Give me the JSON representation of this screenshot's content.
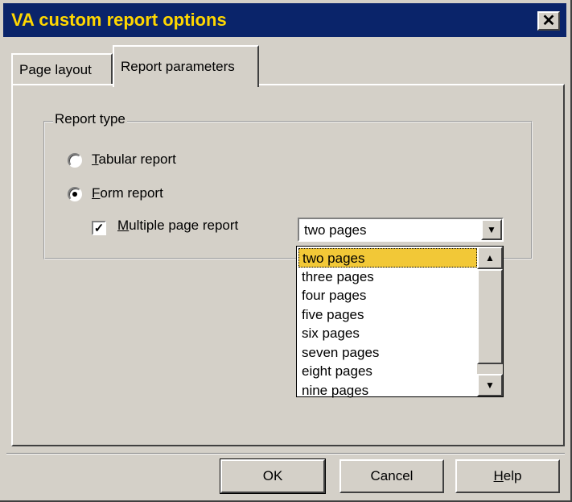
{
  "window": {
    "title": "VA custom report options",
    "close_symbol": "✕"
  },
  "tabs": [
    {
      "label": "Page layout",
      "active": false
    },
    {
      "label": "Report parameters",
      "active": true
    }
  ],
  "report_type": {
    "group_label": "Report type",
    "tabular": {
      "label_mnemonic": "T",
      "label_rest": "abular report",
      "selected": false
    },
    "form": {
      "label_mnemonic": "F",
      "label_rest": "orm report",
      "selected": true
    },
    "multiple_page": {
      "label_mnemonic": "M",
      "label_rest": "ultiple page report",
      "checked": true,
      "check_mark": "✓"
    }
  },
  "pages_combo": {
    "value": "two pages",
    "options": [
      "two pages",
      "three pages",
      "four pages",
      "five pages",
      "six pages",
      "seven pages",
      "eight pages",
      "nine pages"
    ],
    "selected_index": 0
  },
  "buttons": {
    "ok": "OK",
    "cancel": "Cancel",
    "help_mnemonic": "H",
    "help_rest": "elp"
  },
  "colors": {
    "titlebar": "#0a246a",
    "title_text": "#ffd700",
    "selection": "#f2c837",
    "face": "#d4d0c8"
  },
  "icons": {
    "close": "close-icon",
    "combo_arrow": "chevron-down-icon",
    "scroll_up": "scroll-up-icon",
    "scroll_down": "scroll-down-icon"
  }
}
